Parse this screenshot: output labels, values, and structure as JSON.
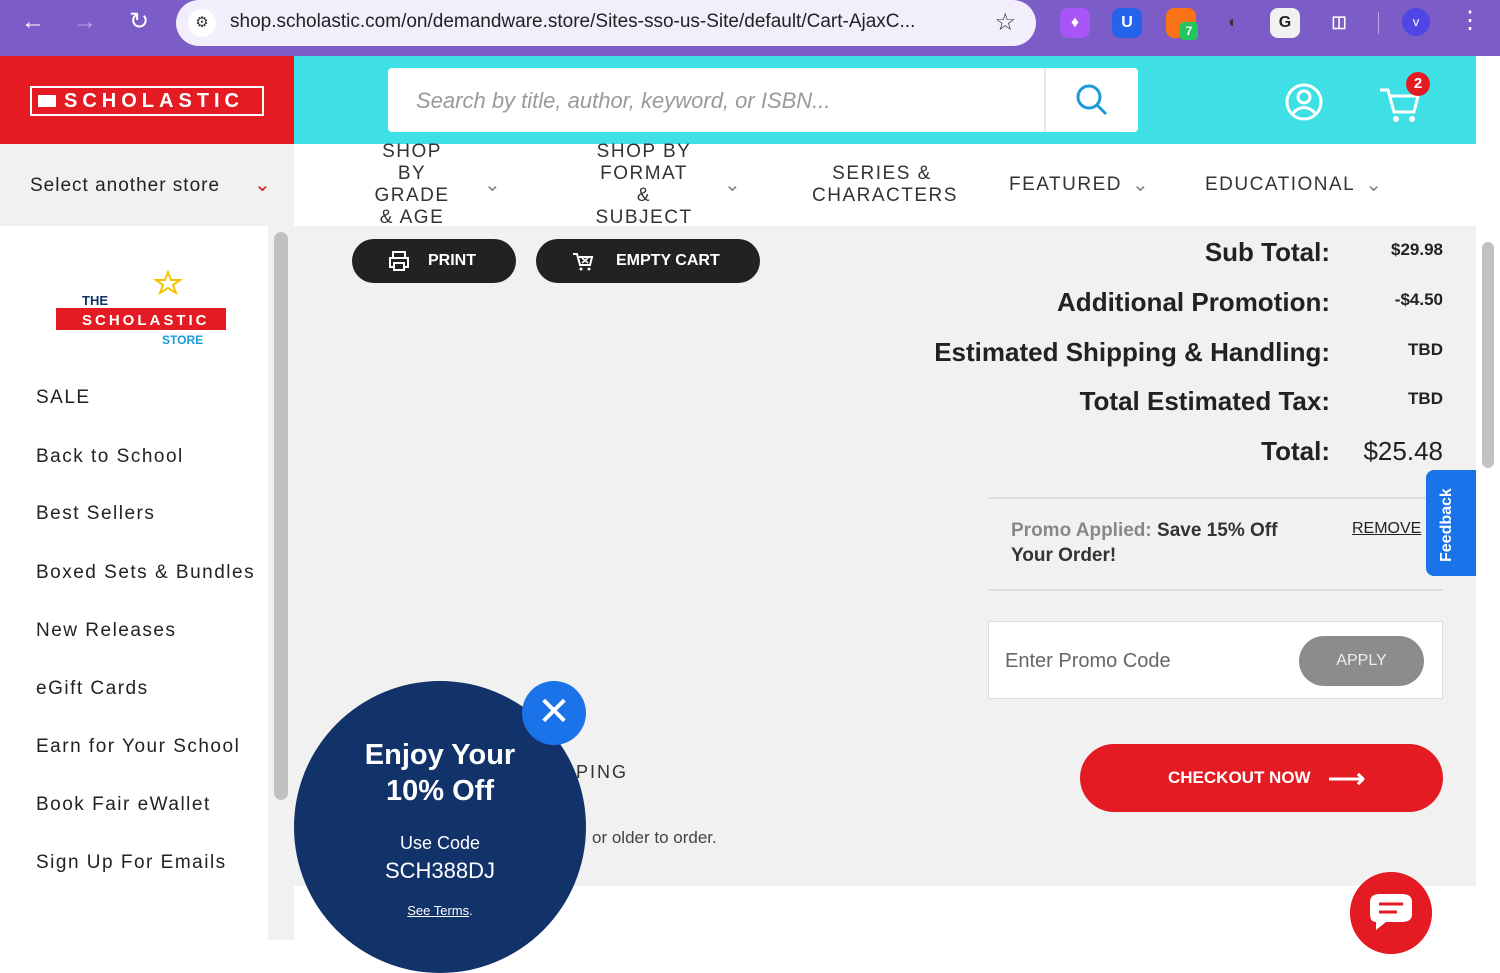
{
  "browser": {
    "url": "shop.scholastic.com/on/demandware.store/Sites-sso-us-Site/default/Cart-AjaxC...",
    "extension_badge": "7",
    "profile_initial": "v"
  },
  "header": {
    "logo_text": "SCHOLASTIC",
    "search_placeholder": "Search by title, author, keyword, or ISBN...",
    "cart_count": "2"
  },
  "store_select": {
    "label": "Select another store"
  },
  "nav": [
    {
      "label": "SHOP BY GRADE & AGE"
    },
    {
      "label": "SHOP BY FORMAT & SUBJECT"
    },
    {
      "label": "SERIES & CHARACTERS"
    },
    {
      "label": "FEATURED"
    },
    {
      "label": "EDUCATIONAL"
    }
  ],
  "sidebar": {
    "store_logo": [
      "THE",
      "SCHOLASTIC",
      "STORE"
    ],
    "items": [
      "SALE",
      "Back to School",
      "Best Sellers",
      "Boxed Sets & Bundles",
      "New Releases",
      "eGift Cards",
      "Earn for Your School",
      "Book Fair eWallet",
      "Sign Up For Emails"
    ]
  },
  "actions": {
    "print": "PRINT",
    "empty_cart": "EMPTY CART"
  },
  "summary": {
    "subtotal_label": "Sub Total:",
    "subtotal_value": "$29.98",
    "promo_label": "Additional Promotion:",
    "promo_value": "-$4.50",
    "shipping_label": "Estimated Shipping & Handling:",
    "shipping_value": "TBD",
    "tax_label": "Total Estimated Tax:",
    "tax_value": "TBD",
    "total_label": "Total:",
    "total_value": "$25.48"
  },
  "promo": {
    "applied_label": "Promo Applied:",
    "applied_text": "Save 15% Off Your Order!",
    "remove_label": "REMOVE",
    "input_placeholder": "Enter Promo Code",
    "apply_label": "APPLY"
  },
  "checkout_label": "CHECKOUT NOW",
  "feedback_label": "Feedback",
  "fragments": {
    "shipping": "PING",
    "age": "or older to order."
  },
  "popup": {
    "headline_line1": "Enjoy Your",
    "headline_line2": "10% Off",
    "use_code_label": "Use Code",
    "code": "SCH388DJ",
    "terms_label": "See Terms"
  },
  "colors": {
    "brand_red": "#e41b23",
    "cyan": "#3ee0e6",
    "navy": "#12326a",
    "blue": "#1a73e8"
  }
}
